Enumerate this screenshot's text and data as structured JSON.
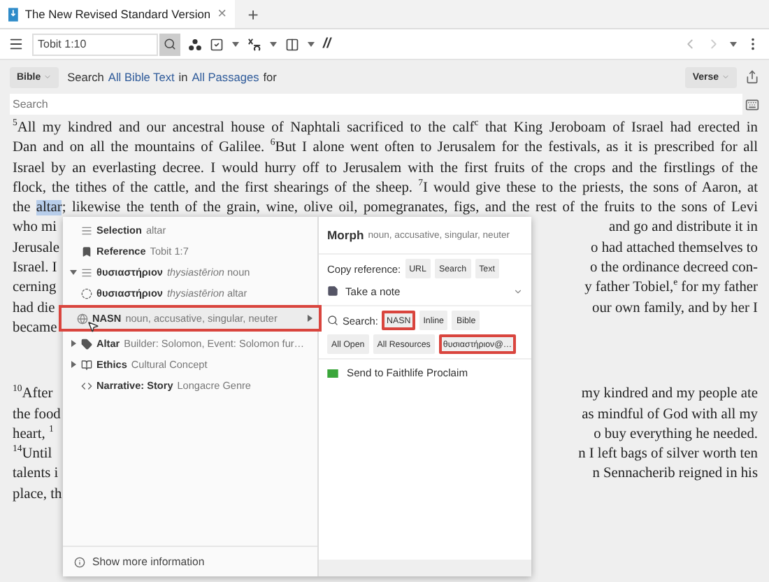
{
  "tab": {
    "title": "The New Revised Standard Version",
    "close": "×",
    "add": "+"
  },
  "toolbar": {
    "location": "Tobit 1:10",
    "parallel": "//"
  },
  "search_bar": {
    "scope": "Bible",
    "parts": [
      {
        "kind": "text",
        "text": "Search"
      },
      {
        "kind": "link",
        "text": "All Bible Text"
      },
      {
        "kind": "text",
        "text": "in"
      },
      {
        "kind": "link",
        "text": "All Passages"
      },
      {
        "kind": "text",
        "text": "for"
      }
    ],
    "unit": "Verse",
    "field": {
      "placeholder": "Search"
    }
  },
  "passage": [
    {
      "kind": "full",
      "segments": [
        {
          "text": "$^{5}$All my kindred and our ancestral house of Naphtali sacrificed to the calf$^{c}$ that King Jeroboam of Israel had erected in",
          "selected": false
        }
      ]
    },
    {
      "kind": "full",
      "segments": [
        {
          "text": "Dan and on all the mountains of Galilee. $^{6}$But I alone went often to Jerusalem for the festivals, as it is prescribed for all",
          "selected": false
        }
      ]
    },
    {
      "kind": "full",
      "segments": [
        {
          "text": "Israel by an everlasting decree. I would hurry off to Jerusalem with the first fruits of the crops and the firstlings of the",
          "selected": false
        }
      ]
    },
    {
      "kind": "full",
      "segments": [
        {
          "text": "flock, the tithes of the cattle, and the first shearings of the sheep. $^{7}$I would give these to the priests, the sons of Aaron, at",
          "selected": false
        }
      ]
    },
    {
      "kind": "full",
      "segments": [
        {
          "text": "the ",
          "selected": false
        },
        {
          "text": "altar",
          "selected": true
        },
        {
          "text": "; likewise the tenth of the grain, wine, olive oil, pomegranates, figs, and the rest of the fruits to the sons of Levi",
          "selected": false
        }
      ]
    },
    {
      "kind": "covered",
      "left": "who mi",
      "right": "and go and distribute it in"
    },
    {
      "kind": "covered",
      "left": "Jerusale",
      "right": "o had attached themselves to"
    },
    {
      "kind": "covered",
      "left": "Israel. I",
      "right": "o the ordinance decreed con-"
    },
    {
      "kind": "covered",
      "left": "cerning",
      "right": "y father Tobiel,$^{e}$ for my father"
    },
    {
      "kind": "covered",
      "left": "had die",
      "right": "our own family, and by her I"
    },
    {
      "kind": "covered",
      "left": "became"
    },
    {
      "kind": "blank"
    },
    {
      "kind": "blank"
    },
    {
      "kind": "covered",
      "left": "$^{10}$After",
      "right": "my kindred and my people ate"
    },
    {
      "kind": "covered",
      "left": "the food",
      "right": "as mindful of God with all my"
    },
    {
      "kind": "covered",
      "left": "heart, $^{1}$",
      "right": "o buy everything he needed."
    },
    {
      "kind": "covered",
      "left": "$^{14}$Until",
      "right": "n I left bags of silver worth ten"
    },
    {
      "kind": "covered",
      "left": "talents i",
      "right": "n Sennacherib reigned in his"
    },
    {
      "kind": "covered",
      "left": "place, th"
    }
  ],
  "info_menu": {
    "items": [
      {
        "label": "Selection",
        "detail": "altar",
        "submenu": false,
        "highlighted": false
      },
      {
        "label": "Reference",
        "detail": "Tobit 1:7",
        "submenu": false,
        "highlighted": false
      },
      {
        "label": "θυσιαστήριον",
        "detail": "*thysiastērion* noun",
        "expanded": true,
        "submenu": false,
        "highlighted": false
      },
      {
        "label": "θυσιαστήριον",
        "detail": "*thysiastērion* altar",
        "submenu": false,
        "highlighted": false
      },
      {
        "label": "NASN",
        "detail": "noun, accusative, singular, neuter",
        "submenu": true,
        "highlighted": true
      },
      {
        "label": "Altar",
        "detail": "Builder: Solomon, Event: Solomon fur…",
        "expanded": false,
        "submenu": false,
        "highlighted": false
      },
      {
        "label": "Ethics",
        "detail": "Cultural Concept",
        "expanded": false,
        "submenu": false,
        "highlighted": false
      },
      {
        "label": "Narrative: Story",
        "detail": "Longacre Genre",
        "submenu": false,
        "highlighted": false
      }
    ],
    "footer": "Show more information"
  },
  "detail_panel": {
    "title": "Morph",
    "subtitle": "noun, accusative, singular, neuter",
    "copy": {
      "label": "Copy reference:",
      "buttons": [
        {
          "label": "URL",
          "highlighted": false
        },
        {
          "label": "Search",
          "highlighted": false
        },
        {
          "label": "Text",
          "highlighted": false
        }
      ]
    },
    "note": "Take a note",
    "search": {
      "label": "Search:",
      "buttons": [
        {
          "label": "NASN",
          "highlighted": true
        },
        {
          "label": "Inline",
          "highlighted": false
        },
        {
          "label": "Bible",
          "highlighted": false
        },
        {
          "label": "All Open",
          "highlighted": false
        },
        {
          "label": "All Resources",
          "highlighted": false
        },
        {
          "label": "θυσιαστήριον@…",
          "highlighted": true
        }
      ]
    },
    "send": "Send to Faithlife Proclaim"
  }
}
